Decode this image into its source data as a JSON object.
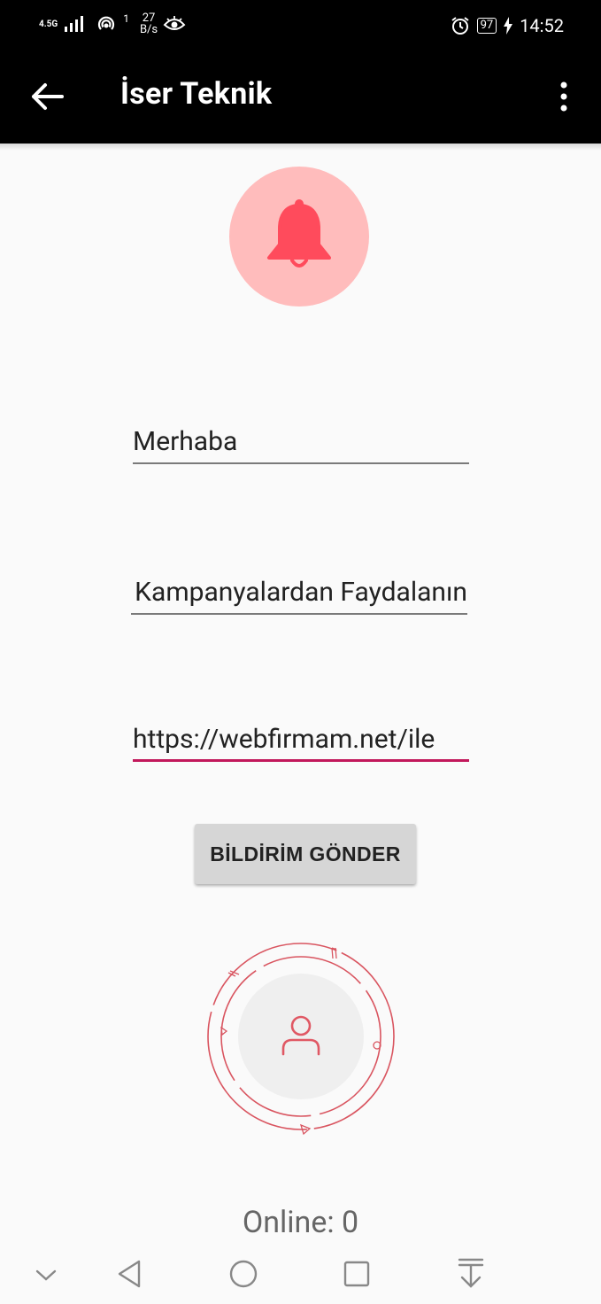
{
  "status_bar": {
    "network": "4.5G",
    "sim_index": "1",
    "speed_value": "27",
    "speed_unit": "B/s",
    "battery": "97",
    "time": "14:52",
    "icons": [
      "signal-icon",
      "hotspot-icon",
      "eye-icon",
      "alarm-icon",
      "battery-icon",
      "charging-icon"
    ]
  },
  "app_bar": {
    "title": "İser Teknik",
    "back_icon": "arrow-left-icon",
    "menu_icon": "more-vertical-icon"
  },
  "header_icon": {
    "name": "bell-icon",
    "circle_color": "#ffbcbc",
    "bell_color": "#ff4b5c"
  },
  "form": {
    "title_value": "Merhaba",
    "message_value": "Kampanyalardan Faydalanın",
    "url_value": "https://webfirmam.net/ile",
    "send_button_label": "BİLDİRİM GÖNDER",
    "accent_color": "#c2185b"
  },
  "online": {
    "label": "Online: 0"
  },
  "nav_bar": {
    "icons": [
      "chevron-down-icon",
      "back-triangle-icon",
      "home-circle-icon",
      "recents-square-icon",
      "download-icon"
    ]
  }
}
